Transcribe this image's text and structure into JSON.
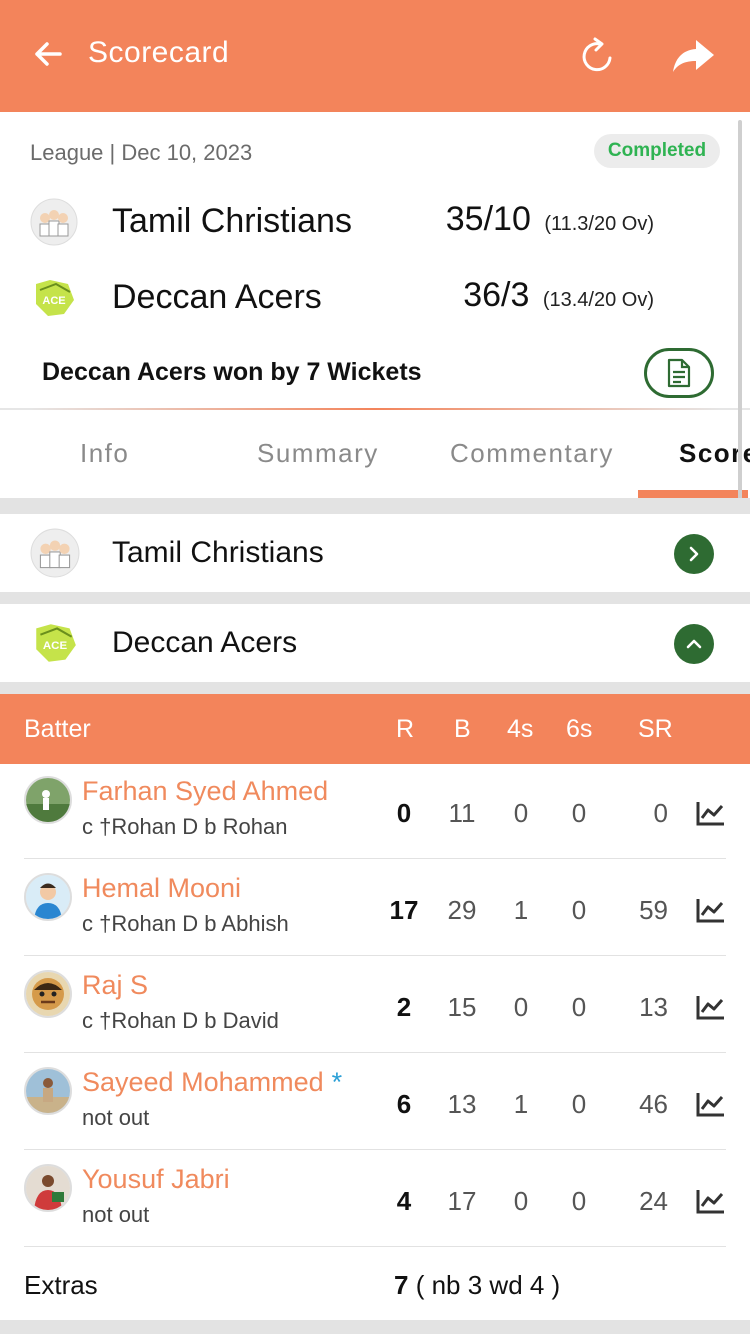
{
  "header": {
    "title": "Scorecard",
    "icons": [
      "arrow-left-icon",
      "refresh-icon",
      "share-icon"
    ]
  },
  "match": {
    "meta": "League | Dec 10, 2023",
    "status": "Completed",
    "teams": [
      {
        "name": "Tamil Christians",
        "score": "35/10",
        "overs": "(11.3/20 Ov)"
      },
      {
        "name": "Deccan Acers",
        "score": "36/3",
        "overs": "(13.4/20 Ov)"
      }
    ],
    "result": "Deccan Acers won by 7 Wickets"
  },
  "tabs": [
    {
      "label": "Info",
      "active": false
    },
    {
      "label": "Summary",
      "active": false
    },
    {
      "label": "Commentary",
      "active": false
    },
    {
      "label": "Scorecard",
      "active": true
    }
  ],
  "innings": [
    {
      "team": "Tamil Christians",
      "expanded": false
    },
    {
      "team": "Deccan Acers",
      "expanded": true
    }
  ],
  "batting": {
    "headers": {
      "batter": "Batter",
      "r": "R",
      "b": "B",
      "fours": "4s",
      "sixes": "6s",
      "sr": "SR"
    },
    "rows": [
      {
        "name": "Farhan Syed Ahmed",
        "dismissal": "c †Rohan D b Rohan",
        "r": "0",
        "b": "11",
        "fours": "0",
        "sixes": "0",
        "sr": "0"
      },
      {
        "name": "Hemal Mooni",
        "dismissal": "c †Rohan D b Abhish",
        "r": "17",
        "b": "29",
        "fours": "1",
        "sixes": "0",
        "sr": "59"
      },
      {
        "name": "Raj S",
        "dismissal": "c †Rohan D b David",
        "r": "2",
        "b": "15",
        "fours": "0",
        "sixes": "0",
        "sr": "13"
      },
      {
        "name": "Sayeed Mohammed",
        "star": "*",
        "dismissal": "not out",
        "r": "6",
        "b": "13",
        "fours": "1",
        "sixes": "0",
        "sr": "46"
      },
      {
        "name": "Yousuf Jabri",
        "dismissal": "not out",
        "r": "4",
        "b": "17",
        "fours": "0",
        "sixes": "0",
        "sr": "24"
      }
    ],
    "extras": {
      "label": "Extras",
      "total": "7",
      "detail": "( nb 3 wd 4 )"
    }
  },
  "colors": {
    "accent": "#f3845b",
    "green": "#2e6b32",
    "completed": "#2fb352",
    "player_name": "#f08a5d"
  }
}
